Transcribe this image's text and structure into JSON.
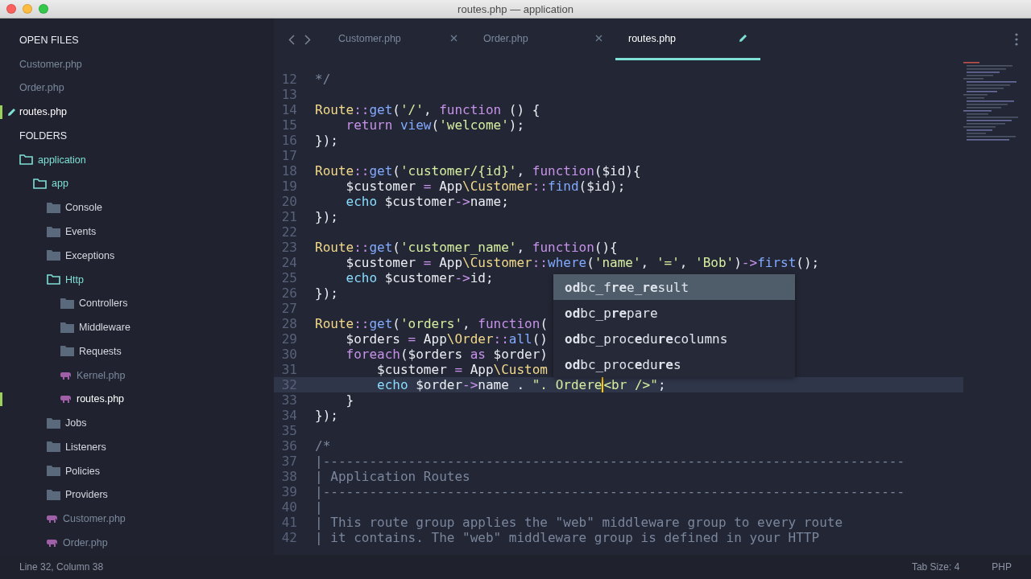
{
  "window": {
    "title": "routes.php — application"
  },
  "sidebar": {
    "open_files_heading": "OPEN FILES",
    "open_files": [
      {
        "name": "Customer.php",
        "selected": false,
        "modified": false
      },
      {
        "name": "Order.php",
        "selected": false,
        "modified": false
      },
      {
        "name": "routes.php",
        "selected": true,
        "modified": true
      }
    ],
    "folders_heading": "FOLDERS",
    "tree": [
      {
        "kind": "folder",
        "name": "application",
        "expanded": true,
        "children": [
          {
            "kind": "folder",
            "name": "app",
            "expanded": true,
            "children": [
              {
                "kind": "folder",
                "name": "Console",
                "expanded": false
              },
              {
                "kind": "folder",
                "name": "Events",
                "expanded": false
              },
              {
                "kind": "folder",
                "name": "Exceptions",
                "expanded": false
              },
              {
                "kind": "folder",
                "name": "Http",
                "expanded": true,
                "children": [
                  {
                    "kind": "folder",
                    "name": "Controllers",
                    "expanded": false
                  },
                  {
                    "kind": "folder",
                    "name": "Middleware",
                    "expanded": false
                  },
                  {
                    "kind": "folder",
                    "name": "Requests",
                    "expanded": false
                  },
                  {
                    "kind": "file",
                    "name": "Kernel.php",
                    "selected": false
                  },
                  {
                    "kind": "file",
                    "name": "routes.php",
                    "selected": true
                  }
                ]
              },
              {
                "kind": "folder",
                "name": "Jobs",
                "expanded": false
              },
              {
                "kind": "folder",
                "name": "Listeners",
                "expanded": false
              },
              {
                "kind": "folder",
                "name": "Policies",
                "expanded": false
              },
              {
                "kind": "folder",
                "name": "Providers",
                "expanded": false
              },
              {
                "kind": "file",
                "name": "Customer.php",
                "selected": false
              },
              {
                "kind": "file",
                "name": "Order.php",
                "selected": false
              }
            ]
          }
        ]
      }
    ]
  },
  "tabs": [
    {
      "label": "Customer.php",
      "selected": false,
      "modified": false
    },
    {
      "label": "Order.php",
      "selected": false,
      "modified": false
    },
    {
      "label": "routes.php",
      "selected": true,
      "modified": true
    }
  ],
  "code": [
    {
      "number": "12",
      "current": false,
      "tokens": [
        {
          "kind": "comment",
          "text": "*/"
        }
      ]
    },
    {
      "number": "13",
      "current": false
    },
    {
      "number": "14",
      "current": false,
      "tokens": [
        {
          "kind": "class",
          "text": "Route"
        },
        {
          "kind": "op",
          "text": "::"
        },
        {
          "kind": "func",
          "text": "get"
        },
        {
          "kind": "plain",
          "text": "("
        },
        {
          "kind": "string",
          "text": "'/'"
        },
        {
          "kind": "plain",
          "text": ", "
        },
        {
          "kind": "keyword",
          "text": "function"
        },
        {
          "kind": "plain",
          "text": " () {"
        }
      ]
    },
    {
      "number": "15",
      "current": false,
      "tokens": [
        {
          "kind": "keyword",
          "text": "    return"
        },
        {
          "kind": "func",
          "text": " view"
        },
        {
          "kind": "plain",
          "text": "("
        },
        {
          "kind": "string",
          "text": "'welcome'"
        },
        {
          "kind": "plain",
          "text": ");"
        }
      ]
    },
    {
      "number": "16",
      "current": false,
      "tokens": [
        {
          "kind": "plain",
          "text": "});"
        }
      ]
    },
    {
      "number": "17",
      "current": false
    },
    {
      "number": "18",
      "current": false,
      "tokens": [
        {
          "kind": "class",
          "text": "Route"
        },
        {
          "kind": "op",
          "text": "::"
        },
        {
          "kind": "func",
          "text": "get"
        },
        {
          "kind": "plain",
          "text": "("
        },
        {
          "kind": "string",
          "text": "'customer/{id}'"
        },
        {
          "kind": "plain",
          "text": ", "
        },
        {
          "kind": "keyword",
          "text": "function"
        },
        {
          "kind": "plain",
          "text": "($id){"
        }
      ]
    },
    {
      "number": "19",
      "current": false,
      "tokens": [
        {
          "kind": "plain",
          "text": "    $customer "
        },
        {
          "kind": "op",
          "text": "="
        },
        {
          "kind": "plain",
          "text": " App"
        },
        {
          "kind": "class",
          "text": "\\Customer"
        },
        {
          "kind": "op",
          "text": "::"
        },
        {
          "kind": "func",
          "text": "find"
        },
        {
          "kind": "plain",
          "text": "($id);"
        }
      ]
    },
    {
      "number": "20",
      "current": false,
      "tokens": [
        {
          "kind": "builtin",
          "text": "    echo"
        },
        {
          "kind": "plain",
          "text": " $customer"
        },
        {
          "kind": "op",
          "text": "->"
        },
        {
          "kind": "plain",
          "text": "name;"
        }
      ]
    },
    {
      "number": "21",
      "current": false,
      "tokens": [
        {
          "kind": "plain",
          "text": "});"
        }
      ]
    },
    {
      "number": "22",
      "current": false
    },
    {
      "number": "23",
      "current": false,
      "tokens": [
        {
          "kind": "class",
          "text": "Route"
        },
        {
          "kind": "op",
          "text": "::"
        },
        {
          "kind": "func",
          "text": "get"
        },
        {
          "kind": "plain",
          "text": "("
        },
        {
          "kind": "string",
          "text": "'customer_name'"
        },
        {
          "kind": "plain",
          "text": ", "
        },
        {
          "kind": "keyword",
          "text": "function"
        },
        {
          "kind": "plain",
          "text": "(){"
        }
      ]
    },
    {
      "number": "24",
      "current": false,
      "tokens": [
        {
          "kind": "plain",
          "text": "    $customer "
        },
        {
          "kind": "op",
          "text": "="
        },
        {
          "kind": "plain",
          "text": " App"
        },
        {
          "kind": "class",
          "text": "\\Customer"
        },
        {
          "kind": "op",
          "text": "::"
        },
        {
          "kind": "func",
          "text": "where"
        },
        {
          "kind": "plain",
          "text": "("
        },
        {
          "kind": "string",
          "text": "'name'"
        },
        {
          "kind": "plain",
          "text": ", "
        },
        {
          "kind": "string",
          "text": "'='"
        },
        {
          "kind": "plain",
          "text": ", "
        },
        {
          "kind": "string",
          "text": "'Bob'"
        },
        {
          "kind": "plain",
          "text": ")"
        },
        {
          "kind": "op",
          "text": "->"
        },
        {
          "kind": "func",
          "text": "first"
        },
        {
          "kind": "plain",
          "text": "();"
        }
      ]
    },
    {
      "number": "25",
      "current": false,
      "tokens": [
        {
          "kind": "builtin",
          "text": "    echo"
        },
        {
          "kind": "plain",
          "text": " $customer"
        },
        {
          "kind": "op",
          "text": "->"
        },
        {
          "kind": "plain",
          "text": "id;"
        }
      ]
    },
    {
      "number": "26",
      "current": false,
      "tokens": [
        {
          "kind": "plain",
          "text": "});"
        }
      ]
    },
    {
      "number": "27",
      "current": false
    },
    {
      "number": "28",
      "current": false,
      "tokens": [
        {
          "kind": "class",
          "text": "Route"
        },
        {
          "kind": "op",
          "text": "::"
        },
        {
          "kind": "func",
          "text": "get"
        },
        {
          "kind": "plain",
          "text": "("
        },
        {
          "kind": "string",
          "text": "'orders'"
        },
        {
          "kind": "plain",
          "text": ", "
        },
        {
          "kind": "keyword",
          "text": "function"
        },
        {
          "kind": "plain",
          "text": "("
        }
      ]
    },
    {
      "number": "29",
      "current": false,
      "tokens": [
        {
          "kind": "plain",
          "text": "    $orders "
        },
        {
          "kind": "op",
          "text": "="
        },
        {
          "kind": "plain",
          "text": " App"
        },
        {
          "kind": "class",
          "text": "\\Order"
        },
        {
          "kind": "op",
          "text": "::"
        },
        {
          "kind": "func",
          "text": "all"
        },
        {
          "kind": "plain",
          "text": "()"
        }
      ]
    },
    {
      "number": "30",
      "current": false,
      "tokens": [
        {
          "kind": "keyword",
          "text": "    foreach"
        },
        {
          "kind": "plain",
          "text": "($orders "
        },
        {
          "kind": "keyword",
          "text": "as"
        },
        {
          "kind": "plain",
          "text": " $order)"
        }
      ]
    },
    {
      "number": "31",
      "current": false,
      "tokens": [
        {
          "kind": "plain",
          "text": "        $customer "
        },
        {
          "kind": "op",
          "text": "="
        },
        {
          "kind": "plain",
          "text": " App"
        },
        {
          "kind": "class",
          "text": "\\Custom"
        }
      ]
    },
    {
      "number": "32",
      "current": true,
      "tokens": [
        {
          "kind": "builtin",
          "text": "        echo"
        },
        {
          "kind": "plain",
          "text": " $order"
        },
        {
          "kind": "op",
          "text": "->"
        },
        {
          "kind": "plain",
          "text": "name . "
        },
        {
          "kind": "string",
          "text": "\". Ordere",
          "cursor_after": true
        },
        {
          "kind": "string",
          "text": "<br />\""
        },
        {
          "kind": "plain",
          "text": ";"
        }
      ]
    },
    {
      "number": "33",
      "current": false,
      "tokens": [
        {
          "kind": "plain",
          "text": "    }"
        }
      ]
    },
    {
      "number": "34",
      "current": false,
      "tokens": [
        {
          "kind": "plain",
          "text": "});"
        }
      ]
    },
    {
      "number": "35",
      "current": false
    },
    {
      "number": "36",
      "current": false,
      "tokens": [
        {
          "kind": "comment",
          "text": "/*"
        }
      ]
    },
    {
      "number": "37",
      "current": false,
      "tokens": [
        {
          "kind": "comment",
          "text": "|---------------------------------------------------------------------------"
        }
      ]
    },
    {
      "number": "38",
      "current": false,
      "tokens": [
        {
          "kind": "comment",
          "text": "| Application Routes"
        }
      ]
    },
    {
      "number": "39",
      "current": false,
      "tokens": [
        {
          "kind": "comment",
          "text": "|---------------------------------------------------------------------------"
        }
      ]
    },
    {
      "number": "40",
      "current": false,
      "tokens": [
        {
          "kind": "comment",
          "text": "|"
        }
      ]
    },
    {
      "number": "41",
      "current": false,
      "tokens": [
        {
          "kind": "comment",
          "text": "| This route group applies the \"web\" middleware group to every route"
        }
      ]
    },
    {
      "number": "42",
      "current": false,
      "tokens": [
        {
          "kind": "comment",
          "text": "| it contains. The \"web\" middleware group is defined in your HTTP"
        }
      ]
    }
  ],
  "autocomplete": [
    {
      "text": "**od**bc_f**re**e_**re**sult",
      "selected": true
    },
    {
      "text": "**od**bc_p**re**pare",
      "selected": false
    },
    {
      "text": "**od**bc_proc**e**du**re**columns",
      "selected": false
    },
    {
      "text": "**od**bc_proc**e**du**re**s",
      "selected": false
    }
  ],
  "status_bar": {
    "position": "Line 32, Column 38",
    "tab_size": "Tab Size: 4",
    "syntax": "PHP"
  }
}
